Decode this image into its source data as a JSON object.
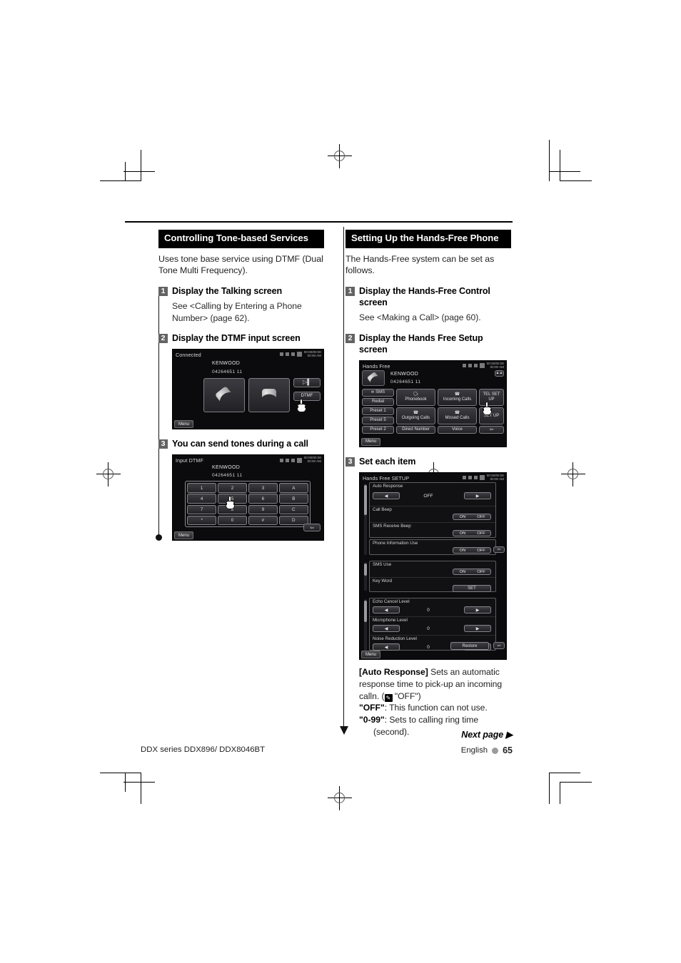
{
  "document": {
    "footer_left": "DDX series   DDX896/ DDX8046BT",
    "footer_language": "English",
    "page_number": "65",
    "next_page": "Next page ▶"
  },
  "left_column": {
    "section_title": "Controlling Tone-based Services",
    "intro": "Uses tone base service using DTMF (Dual Tone Multi Frequency).",
    "steps": [
      {
        "num": "1",
        "label": "Display the Talking screen",
        "sub": "See <Calling by Entering a Phone Number> (page 62)."
      },
      {
        "num": "2",
        "label": "Display the DTMF input screen"
      },
      {
        "num": "3",
        "label": "You can send tones during a call"
      }
    ],
    "screen_connected": {
      "title": "Connected",
      "clock_top": "00:00/00:00",
      "clock_bottom": "00:00 AM",
      "device_name": "KENWOOD",
      "phone_number": "04264651 11",
      "answer_button": "handset-off-hook-icon",
      "hangup_button": "handset-on-hook-icon",
      "volume_button": "volume-icon",
      "dtmf_button": "DTMF",
      "menu_button": "Menu"
    },
    "screen_dtmf": {
      "title": "Input DTMF",
      "clock_top": "00:00/00:00",
      "clock_bottom": "00:00 AM",
      "device_name": "KENWOOD",
      "phone_number": "04264651 11",
      "keys": [
        "1",
        "2",
        "3",
        "A",
        "4",
        "5",
        "6",
        "B",
        "7",
        "8",
        "9",
        "C",
        "*",
        "0",
        "#",
        "D"
      ],
      "back_button": "back-arrow-icon",
      "menu_button": "Menu"
    }
  },
  "right_column": {
    "section_title": "Setting Up the Hands-Free Phone",
    "intro": "The Hands-Free system can be set as follows.",
    "steps": [
      {
        "num": "1",
        "label": "Display the Hands-Free Control screen",
        "sub": "See <Making a Call> (page 60)."
      },
      {
        "num": "2",
        "label": "Display the Hands Free Setup screen"
      },
      {
        "num": "3",
        "label": "Set each item"
      }
    ],
    "screen_handsfree": {
      "title": "Hands Free",
      "clock_top": "00:00/00:00",
      "clock_bottom": "00:00 AM",
      "device_name": "KENWOOD",
      "phone_number": "04264651 11",
      "left_buttons": [
        "SMS",
        "Redial",
        "Preset 1",
        "Preset 5",
        "Preset 2"
      ],
      "grid_buttons": [
        "Phonebook",
        "Incoming Calls",
        "Outgoing Calls",
        "Missed Calls",
        "Direct Number",
        "Voice"
      ],
      "tel_setup_button": "TEL SET UP",
      "setup_button": "SET UP",
      "back_button": "back-arrow-icon",
      "menu_button": "Menu"
    },
    "screen_setup": {
      "title": "Hands Free SETUP",
      "clock_top": "00:00/00:00",
      "clock_bottom": "00:00 AM",
      "panel1": [
        {
          "label": "Auto Response",
          "type": "stepper",
          "value": "OFF"
        },
        {
          "label": "Call Beep",
          "type": "onoff",
          "on": "ON",
          "off": "OFF"
        },
        {
          "label": "SMS Receive Beep",
          "type": "onoff",
          "on": "ON",
          "off": "OFF"
        },
        {
          "label": "Phone Information Use",
          "type": "onoff",
          "on": "ON",
          "off": "OFF"
        }
      ],
      "panel2": [
        {
          "label": "SMS Use",
          "type": "onoff",
          "on": "ON",
          "off": "OFF"
        },
        {
          "label": "Key Word",
          "type": "button",
          "value": "SET"
        }
      ],
      "panel3": [
        {
          "label": "Echo Cancel Level",
          "type": "stepper",
          "value": "0"
        },
        {
          "label": "Microphone Level",
          "type": "stepper",
          "value": "0"
        },
        {
          "label": "Noise Reduction Level",
          "type": "stepper",
          "value": "0"
        }
      ],
      "restore_button": "Restore",
      "back_button": "back-arrow-icon",
      "menu_button": "Menu"
    },
    "description": {
      "key": "[Auto Response]",
      "line1": "Sets an automatic",
      "line2": "response time to pick-up an incoming",
      "line3_pre": "calln. (",
      "line3_post": "\"OFF\")",
      "off_key": "\"OFF\"",
      "off_text": ": This function can not use.",
      "range_key": "\"0-99\"",
      "range_text": ": Sets to calling ring time",
      "range_text2": "(second)."
    }
  },
  "colors": {
    "header_bg": "#000000",
    "step_badge": "#636363",
    "screen_bg": "#0b0b0d",
    "page_dot": "#9b9b9b"
  }
}
